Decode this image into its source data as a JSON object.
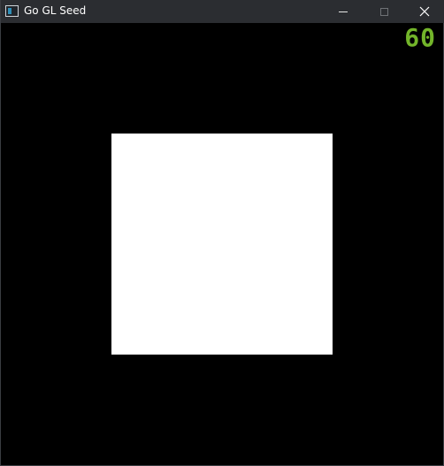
{
  "window": {
    "title": "Go GL Seed",
    "app_icon": "window-app-icon",
    "controls": {
      "minimize_icon": "minimize-icon",
      "maximize_icon": "maximize-icon",
      "close_icon": "close-icon"
    }
  },
  "viewport": {
    "background_color": "#000000",
    "fps_counter": "60",
    "fps_color": "#73b52a",
    "quad_color": "#ffffff"
  }
}
